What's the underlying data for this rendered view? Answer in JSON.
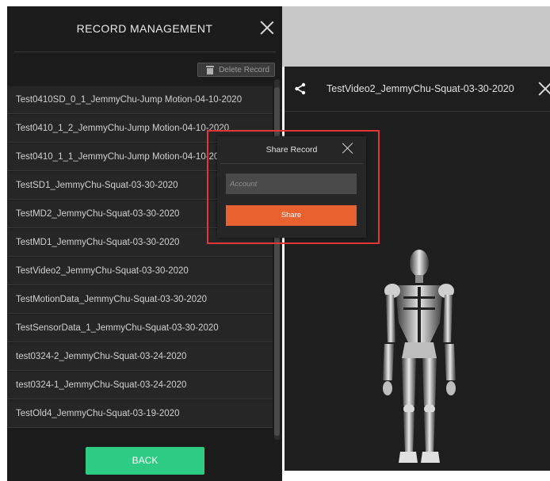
{
  "left_panel": {
    "title": "RECORD MANAGEMENT",
    "delete_label": "Delete Record",
    "back_label": "BACK",
    "records": [
      "Test0410SD_0_1_JemmyChu-Jump Motion-04-10-2020",
      "Test0410_1_2_JemmyChu-Jump Motion-04-10-2020",
      "Test0410_1_1_JemmyChu-Jump Motion-04-10-2020",
      "TestSD1_JemmyChu-Squat-03-30-2020",
      "TestMD2_JemmyChu-Squat-03-30-2020",
      "TestMD1_JemmyChu-Squat-03-30-2020",
      "TestVideo2_JemmyChu-Squat-03-30-2020",
      "TestMotionData_JemmyChu-Squat-03-30-2020",
      "TestSensorData_1_JemmyChu-Squat-03-30-2020",
      "test0324-2_JemmyChu-Squat-03-24-2020",
      "test0324-1_JemmyChu-Squat-03-24-2020",
      "TestOld4_JemmyChu-Squat-03-19-2020"
    ]
  },
  "right_panel": {
    "video_title": "TestVideo2_JemmyChu-Squat-03-30-2020"
  },
  "share_dialog": {
    "title": "Share Record",
    "account_placeholder": "Account",
    "share_label": "Share"
  },
  "colors": {
    "panel_bg": "#1b1b1b",
    "back_button": "#2ecb84",
    "share_button": "#e8612e",
    "highlight": "#e03636"
  },
  "icons": [
    "trash-icon",
    "close-icon",
    "share-icon"
  ]
}
